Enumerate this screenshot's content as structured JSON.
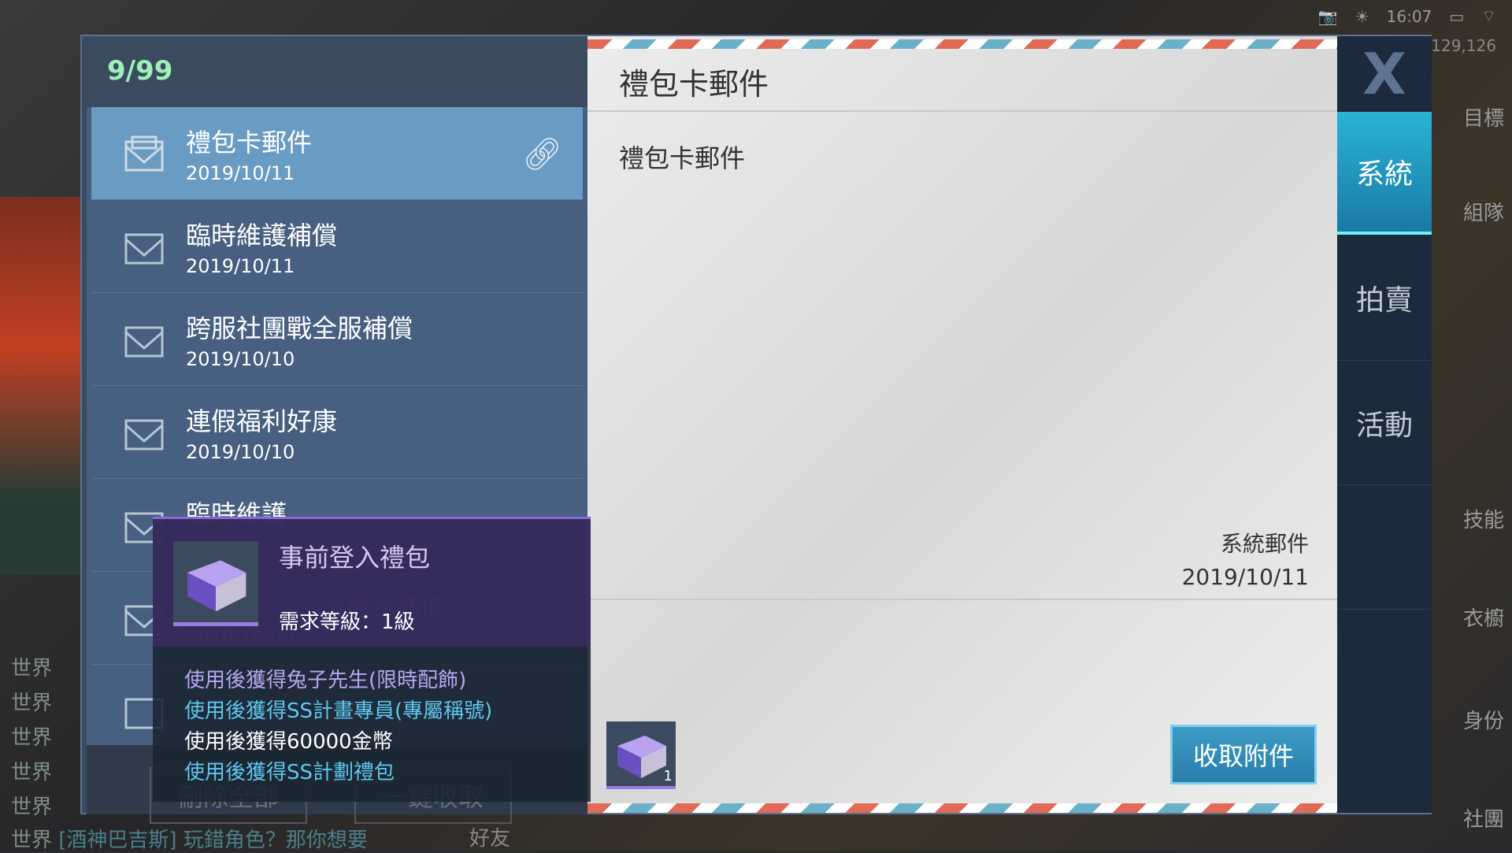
{
  "status": {
    "time": "16:07",
    "coords": "129,126"
  },
  "mail": {
    "count": "9/99",
    "items": [
      {
        "title": "禮包卡郵件",
        "date": "2019/10/11",
        "has_attachment": true
      },
      {
        "title": "臨時維護補償",
        "date": "2019/10/11"
      },
      {
        "title": "跨服社團戰全服補償",
        "date": "2019/10/10"
      },
      {
        "title": "連假福利好康",
        "date": "2019/10/10"
      },
      {
        "title": "臨時維護",
        "date": ""
      },
      {
        "title": "護更新補償",
        "date": "2019/10/09"
      }
    ],
    "delete_all": "刪除全部",
    "collect_all": "一鍵收取"
  },
  "detail": {
    "title": "禮包卡郵件",
    "body": "禮包卡郵件",
    "sender": "系統郵件",
    "date": "2019/10/11",
    "attachment_count": "1",
    "collect_button": "收取附件"
  },
  "tabs": [
    {
      "label": "系統",
      "selected": true
    },
    {
      "label": "拍賣"
    },
    {
      "label": "活動"
    }
  ],
  "tooltip": {
    "name": "事前登入禮包",
    "level": "需求等級：1級",
    "lines": [
      {
        "text": "使用後獲得兔子先生(限時配飾)",
        "color": "#b7a6f0"
      },
      {
        "text": "使用後獲得SS計畫專員(專屬稱號)",
        "color": "#5ec8ee"
      },
      {
        "text": "使用後獲得60000金幣",
        "color": "#ffffff"
      },
      {
        "text": "使用後獲得SS計劃禮包",
        "color": "#5ec8ee"
      }
    ]
  },
  "chat": {
    "channel": "世界",
    "last": "[酒神巴吉斯] 玩錯角色？那你想要",
    "friends": "好友"
  },
  "side": [
    "目標",
    "組隊",
    "技能",
    "衣櫥",
    "身份",
    "社團"
  ]
}
